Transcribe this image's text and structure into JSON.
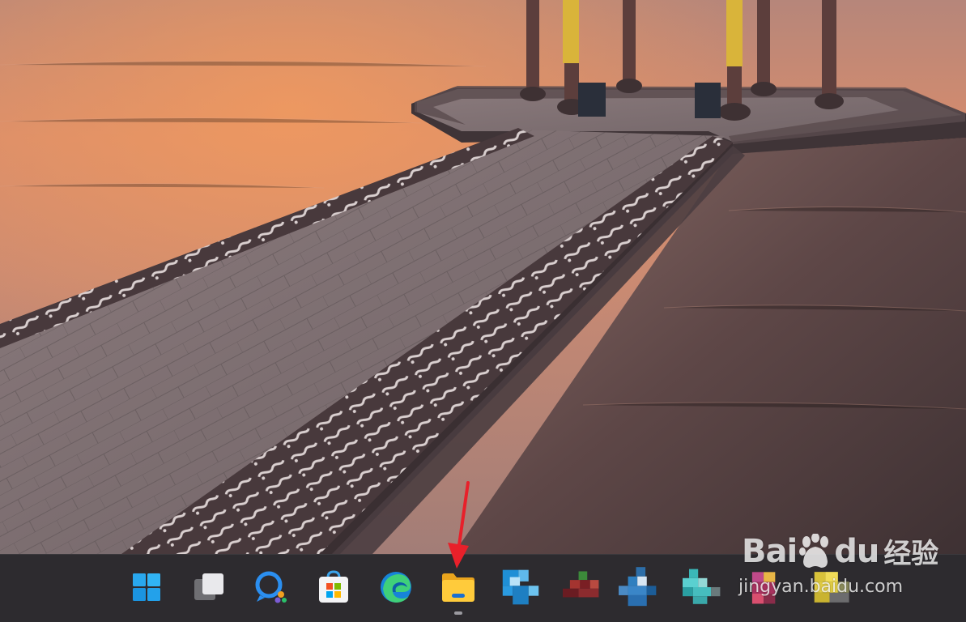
{
  "taskbar": {
    "apps": [
      {
        "id": "start",
        "icon": "windows-start-icon",
        "running": false
      },
      {
        "id": "task-view",
        "icon": "task-view-icon",
        "running": false
      },
      {
        "id": "chat",
        "icon": "chat-icon",
        "running": false
      },
      {
        "id": "store",
        "icon": "microsoft-store-icon",
        "running": false
      },
      {
        "id": "edge",
        "icon": "edge-browser-icon",
        "running": false
      },
      {
        "id": "file-explorer",
        "icon": "file-explorer-icon",
        "running": true
      },
      {
        "id": "pinned-app-1",
        "icon": "blurred-app-icon",
        "running": false
      },
      {
        "id": "pinned-app-2",
        "icon": "blurred-app-icon",
        "running": false
      },
      {
        "id": "pinned-app-3",
        "icon": "blurred-app-icon",
        "running": false
      },
      {
        "id": "pinned-app-4",
        "icon": "blurred-app-icon",
        "running": false
      },
      {
        "id": "pinned-app-5",
        "icon": "blurred-app-icon",
        "running": false
      },
      {
        "id": "pinned-app-6",
        "icon": "blurred-app-icon",
        "running": false
      }
    ]
  },
  "annotation": {
    "arrow_color": "#e8202a",
    "target": "file-explorer"
  },
  "watermark": {
    "brand_left": "Bai",
    "brand_right": "du",
    "brand_cn": "经验",
    "url": "jingyan.baidu.com"
  },
  "colors": {
    "taskbar_bg": "#2d2b2f",
    "sky_top": "#b98a79",
    "sky_glow": "#e8935f",
    "water_dark": "#4a3a3b",
    "accent_blue": "#2b8ff0"
  }
}
